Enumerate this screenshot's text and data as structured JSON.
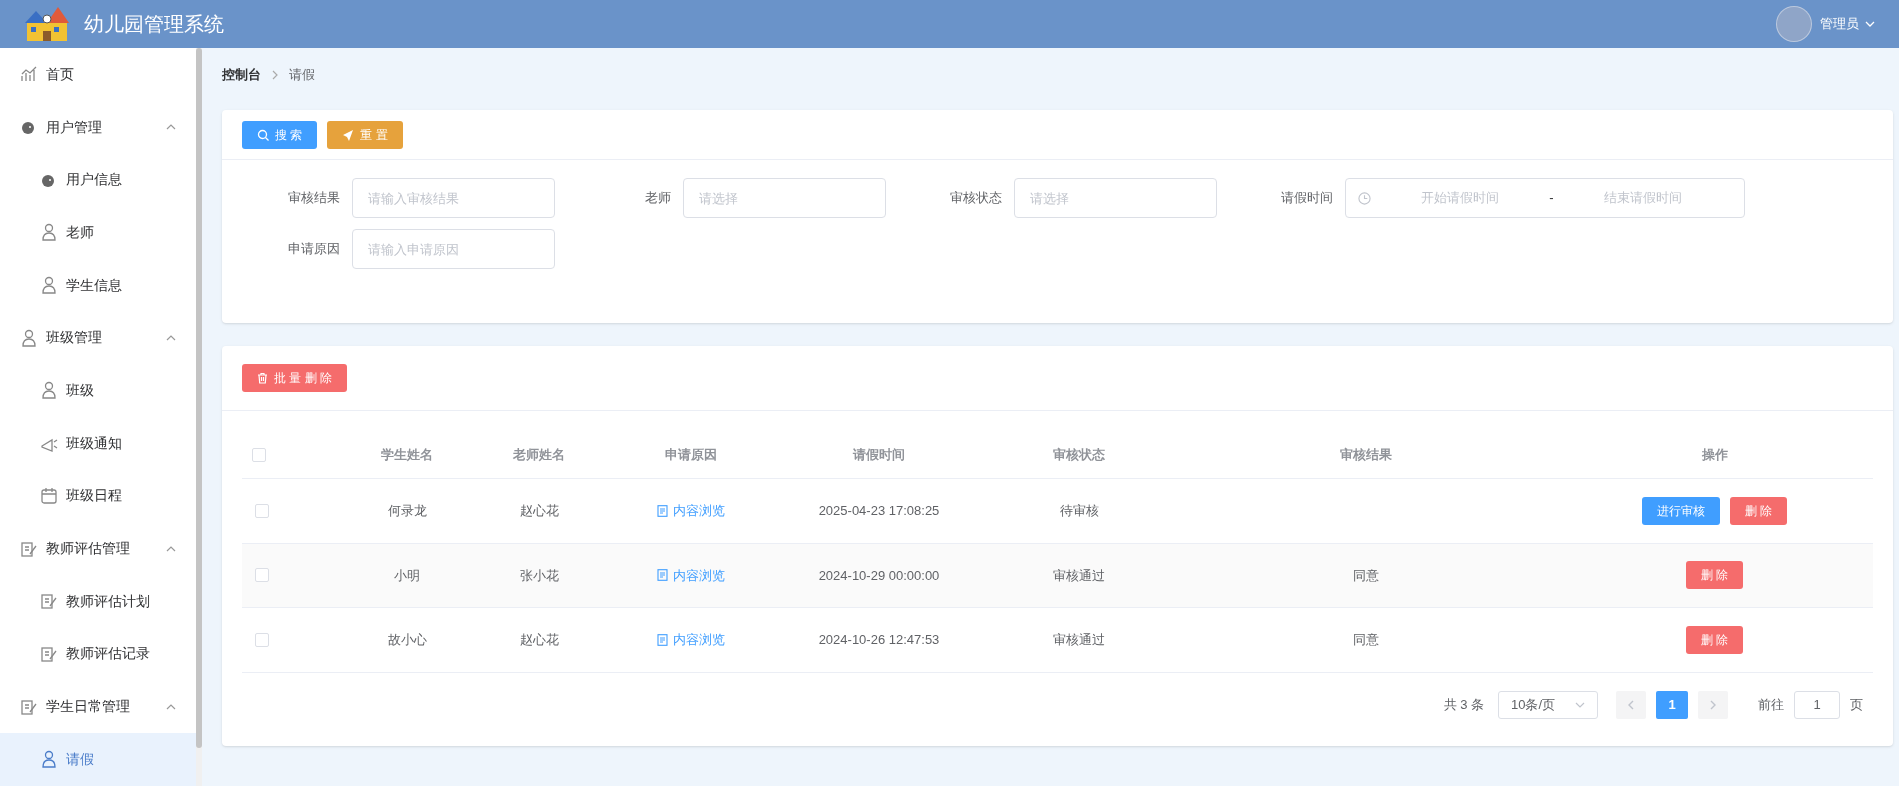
{
  "header": {
    "title": "幼儿园管理系统",
    "user": "管理员"
  },
  "sidebar": {
    "items": [
      {
        "label": "首页",
        "selected": false
      },
      {
        "label": "用户管理",
        "expanded": true,
        "children": [
          {
            "label": "用户信息",
            "selected": false
          },
          {
            "label": "老师",
            "selected": false
          },
          {
            "label": "学生信息",
            "selected": false
          }
        ]
      },
      {
        "label": "班级管理",
        "expanded": true,
        "children": [
          {
            "label": "班级",
            "selected": false
          },
          {
            "label": "班级通知",
            "selected": false
          },
          {
            "label": "班级日程",
            "selected": false
          }
        ]
      },
      {
        "label": "教师评估管理",
        "expanded": true,
        "children": [
          {
            "label": "教师评估计划",
            "selected": false
          },
          {
            "label": "教师评估记录",
            "selected": false
          }
        ]
      },
      {
        "label": "学生日常管理",
        "expanded": true,
        "children": [
          {
            "label": "请假",
            "selected": true
          }
        ]
      }
    ]
  },
  "breadcrumb": [
    "控制台",
    "请假"
  ],
  "toolbar": [
    {
      "label": "搜 索",
      "kind": "search"
    },
    {
      "label": "重 置",
      "kind": "reset"
    }
  ],
  "filters": [
    {
      "label": "审核结果",
      "kind": "input",
      "placeholder": "请输入审核结果"
    },
    {
      "label": "老师",
      "kind": "select",
      "placeholder": "请选择"
    },
    {
      "label": "审核状态",
      "kind": "select",
      "placeholder": "请选择"
    },
    {
      "label": "请假时间",
      "kind": "daterange",
      "start_placeholder": "开始请假时间",
      "separator": "-",
      "end_placeholder": "结束请假时间"
    },
    {
      "label": "申请原因",
      "kind": "input",
      "placeholder": "请输入申请原因"
    }
  ],
  "table": {
    "batch_delete": "批 量 删 除",
    "header_checked": false,
    "columns": [
      "学生姓名",
      "老师姓名",
      "申请原因",
      "请假时间",
      "审核状态",
      "审核结果",
      "操作"
    ],
    "rows": [
      {
        "checked": false,
        "student": "何录龙",
        "teacher": "赵心花",
        "reason": "内容浏览",
        "time": "2025-04-23 17:08:25",
        "status": "待审核",
        "actions": [
          {
            "label": "进行审核",
            "kind": "review"
          },
          {
            "label": "删 除",
            "kind": "delete"
          }
        ]
      },
      {
        "checked": false,
        "student": "小明",
        "teacher": "张小花",
        "reason": "内容浏览",
        "time": "2024-10-29 00:00:00",
        "status": "审核通过",
        "result": "同意",
        "actions": [
          {
            "label": "删 除",
            "kind": "delete"
          }
        ]
      },
      {
        "checked": false,
        "student": "故小心",
        "teacher": "赵心花",
        "reason": "内容浏览",
        "time": "2024-10-26 12:47:53",
        "status": "审核通过",
        "result": "同意",
        "actions": [
          {
            "label": "删 除",
            "kind": "delete"
          }
        ]
      }
    ]
  },
  "pagination": {
    "total": "共 3 条",
    "page_size": "10条/页",
    "pages": [
      {
        "label": "1",
        "selected": true
      }
    ],
    "goto_label": "前往",
    "goto_value": "1",
    "goto_unit": "页"
  }
}
